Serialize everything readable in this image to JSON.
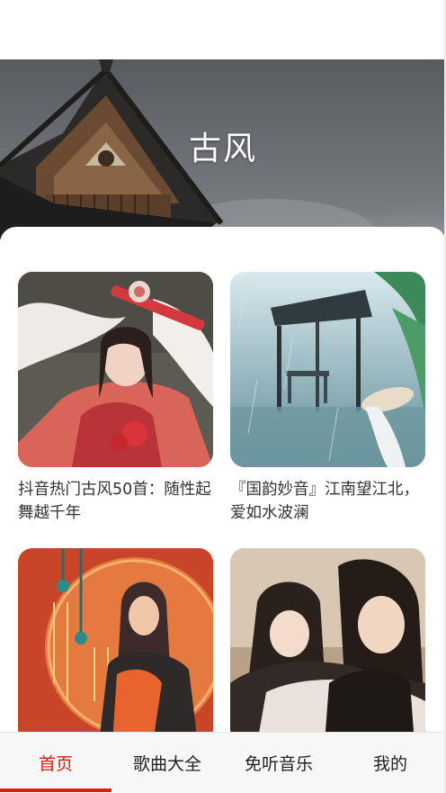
{
  "header": {
    "title": "古风"
  },
  "playlists": [
    {
      "title": "抖音热门古风50首：随性起舞越千年"
    },
    {
      "title": "『国韵妙音』江南望江北，爱如水波澜"
    },
    {
      "title": ""
    },
    {
      "title": ""
    }
  ],
  "tabbar": {
    "tabs": [
      {
        "label": "首页",
        "active": true
      },
      {
        "label": "歌曲大全",
        "active": false
      },
      {
        "label": "免听音乐",
        "active": false
      },
      {
        "label": "我的",
        "active": false
      }
    ]
  },
  "colors": {
    "accent": "#d81e06",
    "text": "#333333"
  }
}
